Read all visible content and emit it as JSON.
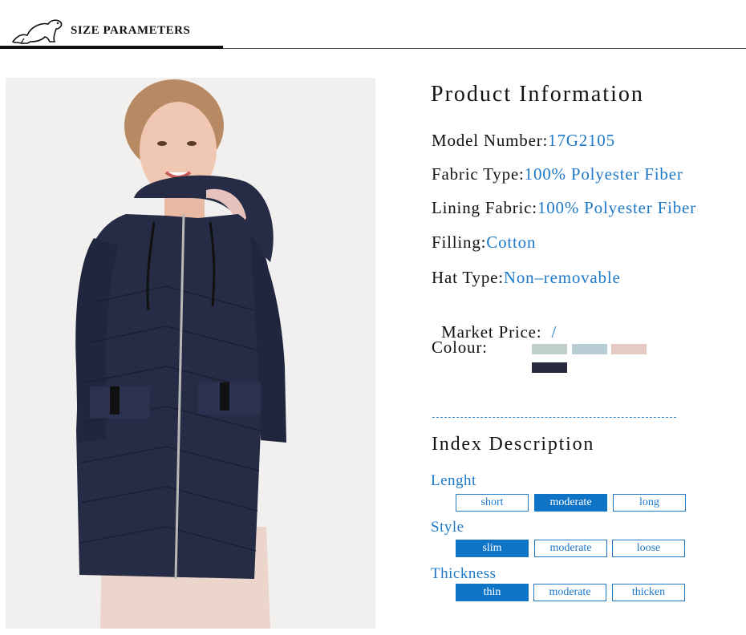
{
  "header": {
    "title": "SIZE PARAMETERS"
  },
  "product": {
    "title": "Product Information",
    "rows": [
      {
        "label": "Model Number:",
        "value": "17G2105"
      },
      {
        "label": "Fabric Type:",
        "value": "100% Polyester Fiber"
      },
      {
        "label": "Lining Fabric:",
        "value": "100% Polyester Fiber"
      },
      {
        "label": "Filling:",
        "value": "Cotton"
      },
      {
        "label": "Hat Type:",
        "value": "Non–removable"
      },
      {
        "label": "Market Price:",
        "value": "  /"
      }
    ],
    "colour_label": "Colour:",
    "colours": [
      "#bfcfc9",
      "#b8ccd3",
      "#e6cbc5",
      "#262a3c"
    ]
  },
  "index": {
    "title": "Index Description",
    "categories": [
      {
        "label": "Lenght",
        "options": [
          "short",
          "moderate",
          "long"
        ],
        "selected": "moderate"
      },
      {
        "label": "Style",
        "options": [
          "slim",
          "moderate",
          "loose"
        ],
        "selected": "slim"
      },
      {
        "label": "Thickness",
        "options": [
          "thin",
          "moderate",
          "thicken"
        ],
        "selected": "thin"
      }
    ]
  },
  "colors": {
    "accent": "#1e78c8",
    "selected_bg": "#1074c6",
    "jacket": "#262c45"
  }
}
